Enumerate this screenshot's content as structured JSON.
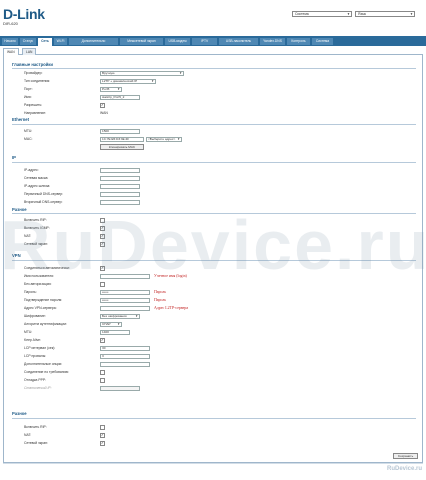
{
  "brand": {
    "logo": "D-Link",
    "model": "DIR-620"
  },
  "header": {
    "system_menu": "Система",
    "language_menu": "Язык"
  },
  "tabs": [
    "Начало",
    "Статус",
    "Сеть",
    "Wi-Fi",
    "Дополнительно",
    "Межсетевой экран",
    "USB-модем",
    "IPTV",
    "USB-накопитель",
    "Yandex.DNS",
    "Контроль",
    "Система"
  ],
  "subtabs": [
    "WAN",
    "LAN"
  ],
  "sections": {
    "main": "Главные настройки",
    "ethernet": "Ethernet",
    "ip": "IP",
    "misc1": "Разное",
    "vpn": "VPN",
    "misc2": "Разное"
  },
  "main": {
    "provider_label": "Провайдер:",
    "provider_value": "Вручную",
    "conn_type_label": "Тип соединения:",
    "conn_type_value": "L2TP + динамический IP",
    "port_label": "Порт:",
    "port_value": "Port5",
    "name_label": "Имя:",
    "name_value": "staticIp_Port5_2",
    "allow_label": "Разрешить:",
    "direction_label": "Направление:",
    "direction_value": "WAN"
  },
  "ethernet": {
    "mtu_label": "MTU:",
    "mtu_value": "1500",
    "mac_label": "MAC:",
    "mac_value": "1C:7E:E5:D3:3E:4F",
    "mac_select": "<Выберите адрес>",
    "clone_button": "Клонировать MAC"
  },
  "ip": {
    "ip_label": "IP-адрес:",
    "mask_label": "Сетевая маска:",
    "gateway_label": "IP-адрес шлюза:",
    "dns1_label": "Первичный DNS-сервер:",
    "dns2_label": "Вторичный DNS-сервер:"
  },
  "misc1": {
    "rip_label": "Включить RIP:",
    "igmp_label": "Включить IGMP:",
    "nat_label": "NAT:",
    "firewall_label": "Сетевой экран:"
  },
  "vpn": {
    "auto_label": "Соединяться автоматически:",
    "user_label": "Имя пользователя:",
    "user_note": "Учетное имя (login)",
    "noauth_label": "Без авторизации:",
    "pass_label": "Пароль:",
    "pass_value": "••••••",
    "pass_note": "Пароль",
    "confirm_label": "Подтверждение пароля:",
    "confirm_value": "••••••",
    "confirm_note": "Пароль",
    "server_label": "Адрес VPN-сервера:",
    "server_note": "Адрес L2TP-сервера",
    "encrypt_label": "Шифрование:",
    "encrypt_value": "Без шифрования",
    "auth_label": "Алгоритм аутентификации:",
    "auth_value": "CHAP",
    "mtu_label": "MTU:",
    "mtu_value": "1400",
    "keepalive_label": "Keep Alive:",
    "lcp_interval_label": "LCP интервал (сек):",
    "lcp_interval_value": "30",
    "lcp_fails_label": "LCP провалы:",
    "lcp_fails_value": "3",
    "extra_label": "Дополнительные опции:",
    "ondemand_label": "Соединение по требованию:",
    "debug_label": "Отладка PPP:",
    "static_ip_label": "Статический IP:"
  },
  "misc2": {
    "rip_label": "Включить RIP:",
    "nat_label": "NAT:",
    "firewall_label": "Сетевой экран:"
  },
  "save_button": "Сохранить",
  "watermark": "RuDevice.ru",
  "watermark_small": "RuDevice.ru"
}
